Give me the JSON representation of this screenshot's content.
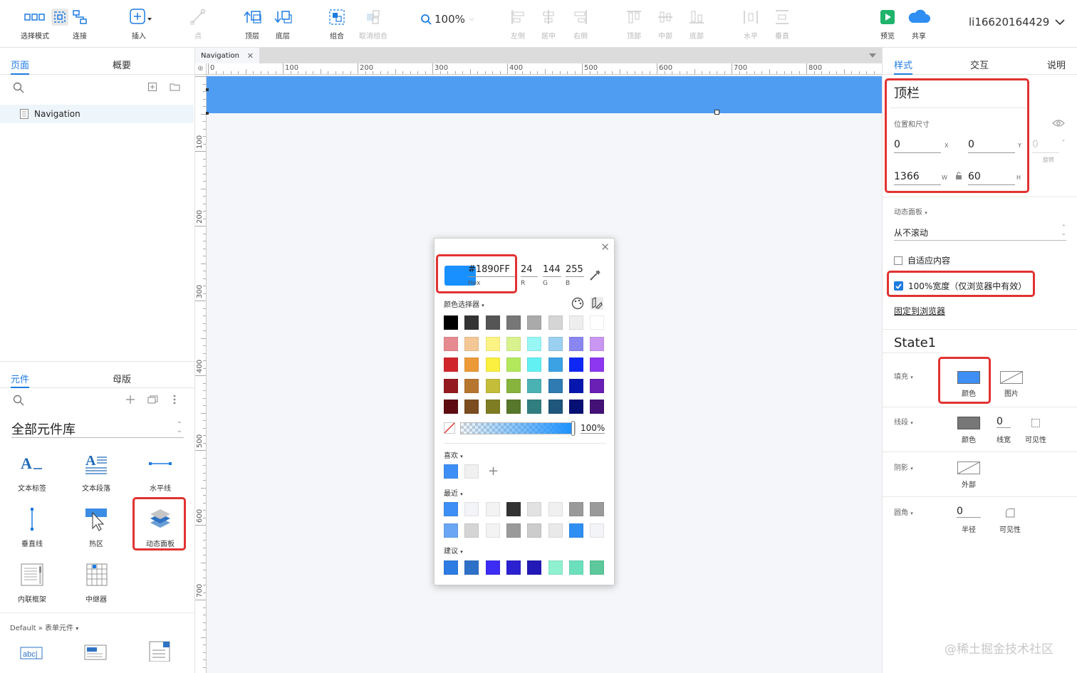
{
  "toolbar": {
    "select_mode": "选择模式",
    "connect": "连接",
    "insert": "插入",
    "point": "点",
    "top_layer": "顶层",
    "bottom_layer": "底层",
    "group": "组合",
    "ungroup": "取消组合",
    "zoom": "100%",
    "align_left": "左侧",
    "align_center": "居中",
    "align_right": "右侧",
    "align_top": "顶部",
    "align_middle": "中部",
    "align_bottom": "底部",
    "dist_h": "水平",
    "dist_v": "垂直",
    "preview": "预览",
    "share": "共享",
    "user": "li16620164429"
  },
  "left_panel": {
    "tabs": [
      "页面",
      "概要"
    ],
    "page_item": "Navigation",
    "widget_tabs": [
      "元件",
      "母版"
    ],
    "library_title": "全部元件库",
    "widgets": [
      {
        "name": "text-label-widget",
        "label": "文本标签"
      },
      {
        "name": "text-paragraph-widget",
        "label": "文本段落"
      },
      {
        "name": "horizontal-line-widget",
        "label": "水平线"
      },
      {
        "name": "vertical-line-widget",
        "label": "垂直线"
      },
      {
        "name": "hotspot-widget",
        "label": "热区"
      },
      {
        "name": "dynamic-panel-widget",
        "label": "动态面板"
      },
      {
        "name": "inline-frame-widget",
        "label": "内联框架"
      },
      {
        "name": "repeater-widget",
        "label": "中继器"
      }
    ],
    "form_path": "Default » 表单元件",
    "form_icon_text": "abc|"
  },
  "canvas": {
    "doc_tab": "Navigation",
    "ruler_h": [
      "0",
      "100",
      "200",
      "300",
      "400",
      "500",
      "600",
      "700",
      "800"
    ],
    "ruler_v": [
      "100",
      "200",
      "300",
      "400",
      "500",
      "600",
      "700"
    ],
    "navbar_color": "#4f9cf3"
  },
  "color_picker": {
    "hex": "#1890FF",
    "hex_label": "Hex",
    "r": "24",
    "g": "144",
    "b": "255",
    "r_label": "R",
    "g_label": "G",
    "b_label": "B",
    "selector_label": "颜色选择器",
    "opacity": "100%",
    "favorites_label": "喜欢",
    "recent_label": "最近",
    "suggest_label": "建议",
    "palette": [
      [
        "#000000",
        "#333333",
        "#555555",
        "#777777",
        "#aaaaaa",
        "#d5d5d5",
        "#eeeeee",
        "#ffffff"
      ],
      [
        "#e68a91",
        "#f4c796",
        "#fdf384",
        "#d9f28f",
        "#98f6f5",
        "#9bd0f0",
        "#8a86f0",
        "#c996f1"
      ],
      [
        "#d0262b",
        "#ec9a38",
        "#fbef3f",
        "#b4e85c",
        "#63f0f2",
        "#3ba2e4",
        "#0f27f5",
        "#8d37f0"
      ],
      [
        "#951a1f",
        "#b7762f",
        "#c3bd3a",
        "#86b43d",
        "#4bb2b4",
        "#2f7bb2",
        "#0717ad",
        "#6a1fb5"
      ],
      [
        "#5d0c12",
        "#7b4c20",
        "#7f7d23",
        "#57772a",
        "#307e80",
        "#1f567c",
        "#060f73",
        "#441277"
      ]
    ],
    "favorites": [
      "#3d8ff5",
      "#f0f0f0"
    ],
    "recent": [
      [
        "#3d8ff5",
        "#f3f4f8",
        "#f3f3f3",
        "#333333",
        "#e2e2e2",
        "#f0f0f0",
        "#9a9a9a",
        "#9a9a9a"
      ],
      [
        "#6aa6f4",
        "#d5d5d5",
        "#f3f3f3",
        "#9a9a9a",
        "#cccccc",
        "#e9e9e9",
        "#2e8ff3",
        "#f3f4f8"
      ]
    ],
    "suggest": [
      "#2d7ce3",
      "#2d70c8",
      "#3c2cf4",
      "#2c21d0",
      "#2319b6",
      "#8ff1cf",
      "#6ce0bc",
      "#5cc89c"
    ]
  },
  "right_panel": {
    "tabs": [
      "样式",
      "交互",
      "说明"
    ],
    "widget_name": "顶栏",
    "pos_size_label": "位置和尺寸",
    "x": "0",
    "y": "0",
    "w": "1366",
    "h": "60",
    "rotation": "0",
    "rotation_label": "旋转",
    "x_label": "X",
    "y_label": "Y",
    "w_label": "W",
    "h_label": "H",
    "dyn_panel_label": "动态面板",
    "scroll_value": "从不滚动",
    "fit_content": "自适应内容",
    "full_width": "100%宽度（仅浏览器中有效）",
    "pin_browser": "固定到浏览器",
    "state": "State1",
    "fill_label": "填充",
    "fill_color": "颜色",
    "fill_image": "图片",
    "stroke_label": "线段",
    "stroke_color": "颜色",
    "stroke_width": "0",
    "stroke_width_label": "线宽",
    "stroke_visibility": "可见性",
    "shadow_label": "阴影",
    "shadow_outer": "外部",
    "radius_label": "圆角",
    "radius": "0",
    "radius_caption": "半径",
    "radius_visibility": "可见性",
    "fill_hex": "#3d8ff5"
  },
  "watermark": "@稀土掘金技术社区"
}
